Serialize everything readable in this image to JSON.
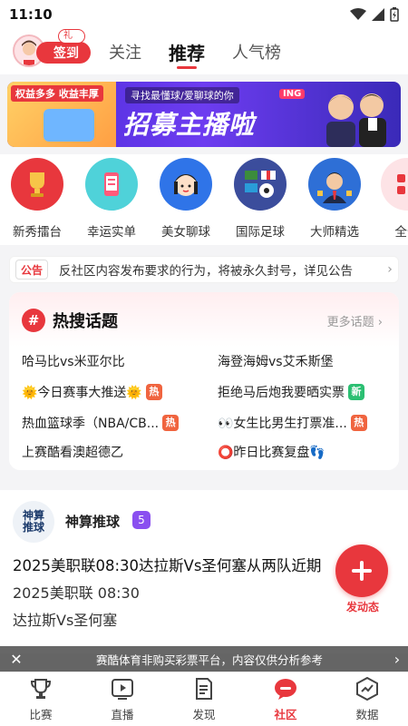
{
  "status": {
    "time": "11:10"
  },
  "header": {
    "checkin_label": "签到",
    "gift_label": "礼包",
    "tabs": [
      {
        "label": "关注"
      },
      {
        "label": "推荐"
      },
      {
        "label": "人气榜"
      }
    ],
    "active_tab": "推荐"
  },
  "banner": {
    "tag": "权益多多 收益丰厚",
    "subtitle": "寻找最懂球/爱聊球的你",
    "badge": "ING",
    "headline": "招募主播啦"
  },
  "categories": [
    {
      "label": "新秀擂台",
      "icon": "trophy-icon"
    },
    {
      "label": "幸运实单",
      "icon": "phone-ticket-icon"
    },
    {
      "label": "美女聊球",
      "icon": "girl-icon"
    },
    {
      "label": "国际足球",
      "icon": "flags-football-icon"
    },
    {
      "label": "大师精选",
      "icon": "master-icon"
    },
    {
      "label": "全部",
      "icon": "grid-icon"
    }
  ],
  "notice": {
    "badge": "公告",
    "text": "反社区内容发布要求的行为，将被永久封号，详见公告"
  },
  "hot_topics": {
    "title": "热搜话题",
    "more": "更多话题",
    "items": [
      {
        "text": "哈马比vs米亚尔比",
        "tag": ""
      },
      {
        "text": "海登海姆vs艾禾斯堡",
        "tag": ""
      },
      {
        "text": "🌞今日赛事大推送🌞",
        "tag": "热"
      },
      {
        "text": "拒绝马后炮我要晒实票",
        "tag": "新"
      },
      {
        "text": "热血篮球季（NBA/CB...",
        "tag": "热"
      },
      {
        "text": "👀女生比男生打票准...",
        "tag": "热"
      },
      {
        "text": "上赛酷看澳超德乙",
        "tag": ""
      },
      {
        "text": "⭕昨日比赛复盘👣",
        "tag": ""
      }
    ]
  },
  "post": {
    "avatar_text": "神算\n推球",
    "author": "神算推球",
    "level": "5",
    "title": "2025美职联08:30达拉斯Vs圣何塞从两队近期",
    "line1": "2025美职联 08:30",
    "line2": "达拉斯Vs圣何塞"
  },
  "fab": {
    "label": "发动态"
  },
  "disclaimer": {
    "text": "赛酷体育非购买彩票平台，内容仅供分析参考"
  },
  "bottom_nav": [
    {
      "label": "比赛",
      "icon": "trophy-cup-icon"
    },
    {
      "label": "直播",
      "icon": "play-icon"
    },
    {
      "label": "发现",
      "icon": "document-icon"
    },
    {
      "label": "社区",
      "icon": "community-icon"
    },
    {
      "label": "数据",
      "icon": "chart-icon"
    }
  ],
  "colors": {
    "accent": "#e8373d",
    "hot_tag": "#f0643f",
    "new_tag": "#2bbf72"
  }
}
